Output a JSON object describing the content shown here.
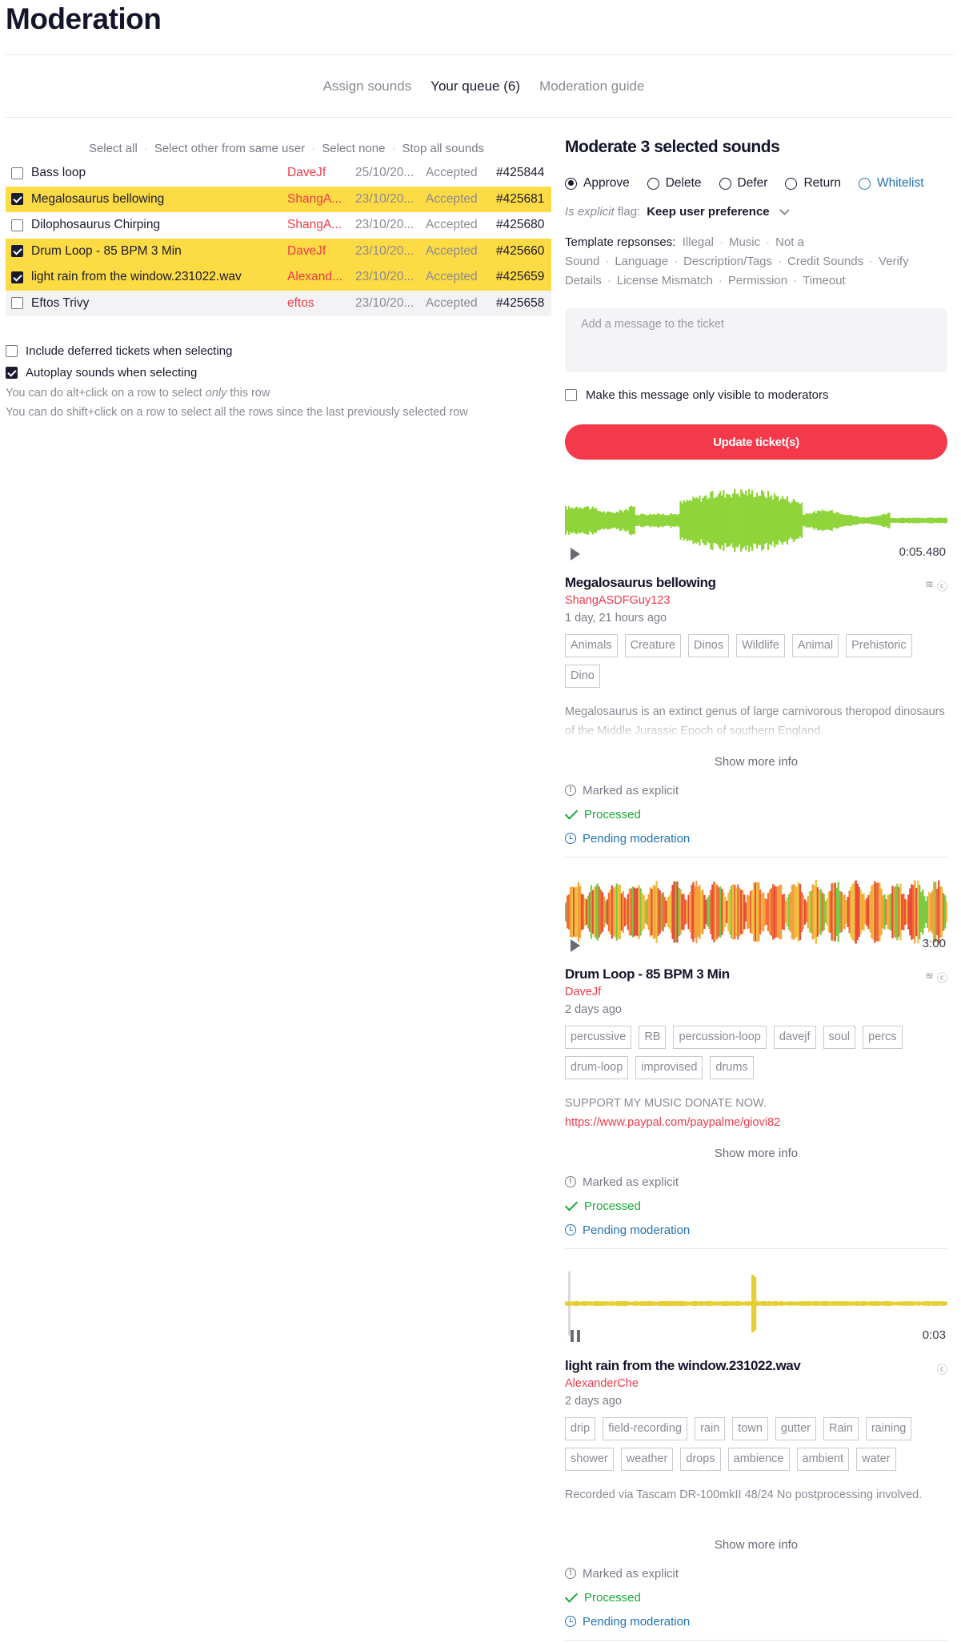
{
  "page": {
    "title": "Moderation"
  },
  "tabs": [
    {
      "label": "Assign sounds"
    },
    {
      "label": "Your queue (6)"
    },
    {
      "label": "Moderation guide"
    }
  ],
  "selection_actions": [
    "Select all",
    "Select other from same user",
    "Select none",
    "Stop all sounds"
  ],
  "queue": {
    "rows": [
      {
        "name": "Bass loop",
        "user": "DaveJf",
        "date": "25/10/20...",
        "status": "Accepted",
        "id": "#425844",
        "selected": false
      },
      {
        "name": "Megalosaurus bellowing",
        "user": "ShangA...",
        "date": "23/10/20...",
        "status": "Accepted",
        "id": "#425681",
        "selected": true
      },
      {
        "name": "Dilophosaurus Chirping",
        "user": "ShangA...",
        "date": "23/10/20...",
        "status": "Accepted",
        "id": "#425680",
        "selected": false
      },
      {
        "name": "Drum Loop - 85 BPM 3 Min",
        "user": "DaveJf",
        "date": "23/10/20...",
        "status": "Accepted",
        "id": "#425660",
        "selected": true
      },
      {
        "name": "light rain from the window.231022.wav",
        "user": "Alexand...",
        "date": "23/10/20...",
        "status": "Accepted",
        "id": "#425659",
        "selected": true
      },
      {
        "name": "Eftos Trivy",
        "user": "eftos",
        "date": "23/10/20...",
        "status": "Accepted",
        "id": "#425658",
        "selected": false
      }
    ]
  },
  "options": {
    "include_deferred": "Include deferred tickets when selecting",
    "autoplay": "Autoplay sounds when selecting",
    "help_alt_pre": "You can do alt+click on a row to select ",
    "help_alt_em": "only",
    "help_alt_post": " this row",
    "help_shift": "You can do shift+click on a row to select all the rows since the last previously selected row"
  },
  "moderate": {
    "title": "Moderate 3 selected sounds",
    "actions": [
      "Approve",
      "Delete",
      "Defer",
      "Return",
      "Whitelist"
    ],
    "selected_action": "Approve",
    "flag_label_em": "Is explicit",
    "flag_label_rest": " flag:",
    "flag_value": "Keep user preference",
    "templates_label": "Template repsonses:",
    "templates": [
      "Illegal",
      "Music",
      "Not a Sound",
      "Language",
      "Description/Tags",
      "Credit Sounds",
      "Verify Details",
      "License Mismatch",
      "Permission",
      "Timeout"
    ],
    "message_placeholder": "Add a message to the ticket",
    "mod_only_label": "Make this message only visible to moderators",
    "update_button": "Update ticket(s)"
  },
  "sounds": [
    {
      "name": "Megalosaurus bellowing",
      "user": "ShangASDFGuy123",
      "time": "1 day, 21 hours ago",
      "duration": "0:05.480",
      "wave_color": "#8fd43a",
      "player_state": "paused",
      "tags": [
        "Animals",
        "Creature",
        "Dinos",
        "Wildlife",
        "Animal",
        "Prehistoric",
        "Dino"
      ],
      "description": "Megalosaurus is an extinct genus of large carnivorous theropod dinosaurs of the Middle Jurassic Epoch of southern England.",
      "link": "",
      "show_more": "Show more info",
      "explicit": "Marked as explicit",
      "processed": "Processed",
      "pending": "Pending moderation"
    },
    {
      "name": "Drum Loop - 85 BPM 3 Min",
      "user": "DaveJf",
      "time": "2 days ago",
      "duration": "3:00",
      "wave_color": "#f26a3a",
      "player_state": "paused",
      "tags": [
        "percussive",
        "RB",
        "percussion-loop",
        "davejf",
        "soul",
        "percs",
        "drum-loop",
        "improvised",
        "drums"
      ],
      "description": "SUPPORT MY MUSIC DONATE NOW.",
      "link": "https://www.paypal.com/paypalme/giovi82",
      "show_more": "Show more info",
      "explicit": "Marked as explicit",
      "processed": "Processed",
      "pending": "Pending moderation"
    },
    {
      "name": "light rain from the window.231022.wav",
      "user": "AlexanderChe",
      "time": "2 days ago",
      "duration": "0:03",
      "wave_color": "#e6cf36",
      "player_state": "playing",
      "tags": [
        "drip",
        "field-recording",
        "rain",
        "town",
        "gutter",
        "Rain",
        "raining",
        "shower",
        "weather",
        "drops",
        "ambience",
        "ambient",
        "water"
      ],
      "description": "Recorded via Tascam DR-100mkII 48/24 No postprocessing involved.",
      "link": "",
      "show_more": "Show more info",
      "explicit": "Marked as explicit",
      "processed": "Processed",
      "pending": "Pending moderation"
    }
  ]
}
